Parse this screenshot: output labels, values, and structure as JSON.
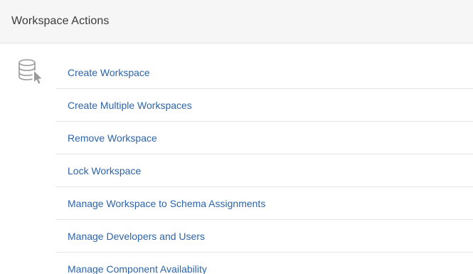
{
  "header": {
    "title": "Workspace Actions"
  },
  "region": {
    "icon": "database-pointer-icon"
  },
  "actions": [
    {
      "label": "Create Workspace"
    },
    {
      "label": "Create Multiple Workspaces"
    },
    {
      "label": "Remove Workspace"
    },
    {
      "label": "Lock Workspace"
    },
    {
      "label": "Manage Workspace to Schema Assignments"
    },
    {
      "label": "Manage Developers and Users"
    },
    {
      "label": "Manage Component Availability"
    }
  ],
  "colors": {
    "link": "#2d64a8",
    "header_bg": "#f6f6f6",
    "title_text": "#3b3b3b",
    "divider": "#e6e6e6"
  }
}
